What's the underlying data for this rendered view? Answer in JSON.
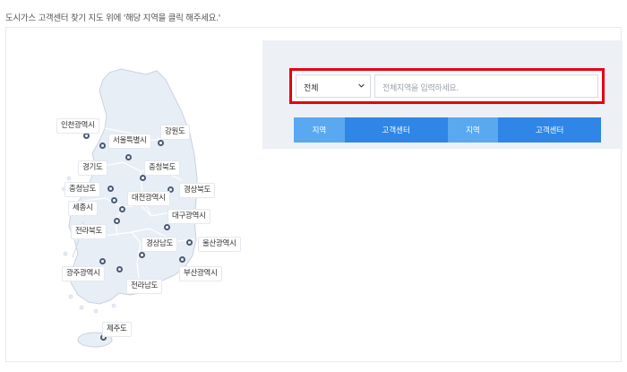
{
  "instruction": "도시가스 고객센터 찾기 지도 위에 '해당 지역을 클릭 해주세요.'",
  "map": {
    "regions": [
      {
        "name": "seoul",
        "label": "서울특별시"
      },
      {
        "name": "incheon",
        "label": "인천광역시"
      },
      {
        "name": "gangwon",
        "label": "강원도"
      },
      {
        "name": "gyeonggi",
        "label": "경기도"
      },
      {
        "name": "chungbuk",
        "label": "충청북도"
      },
      {
        "name": "chungnam",
        "label": "충청남도"
      },
      {
        "name": "daejeon",
        "label": "대전광역시"
      },
      {
        "name": "gyeongbuk",
        "label": "경상북도"
      },
      {
        "name": "sejong",
        "label": "세종시"
      },
      {
        "name": "daegu",
        "label": "대구광역시"
      },
      {
        "name": "jeonbuk",
        "label": "전라북도"
      },
      {
        "name": "gyeongnam",
        "label": "경상남도"
      },
      {
        "name": "ulsan",
        "label": "울산광역시"
      },
      {
        "name": "gwangju",
        "label": "광주광역시"
      },
      {
        "name": "busan",
        "label": "부산광역시"
      },
      {
        "name": "jeonnam",
        "label": "전라남도"
      },
      {
        "name": "jeju",
        "label": "제주도"
      }
    ]
  },
  "search": {
    "select_value": "전체",
    "placeholder": "전체지역을 입력하세요."
  },
  "tabs": [
    "지역",
    "고객센터",
    "지역",
    "고객센터"
  ],
  "colors": {
    "highlight": "#e60012",
    "tab_light": "#5aa8f0",
    "tab_dark": "#2f86e6",
    "panel_bg": "#edf1f6",
    "map_fill": "#e8eef6"
  }
}
